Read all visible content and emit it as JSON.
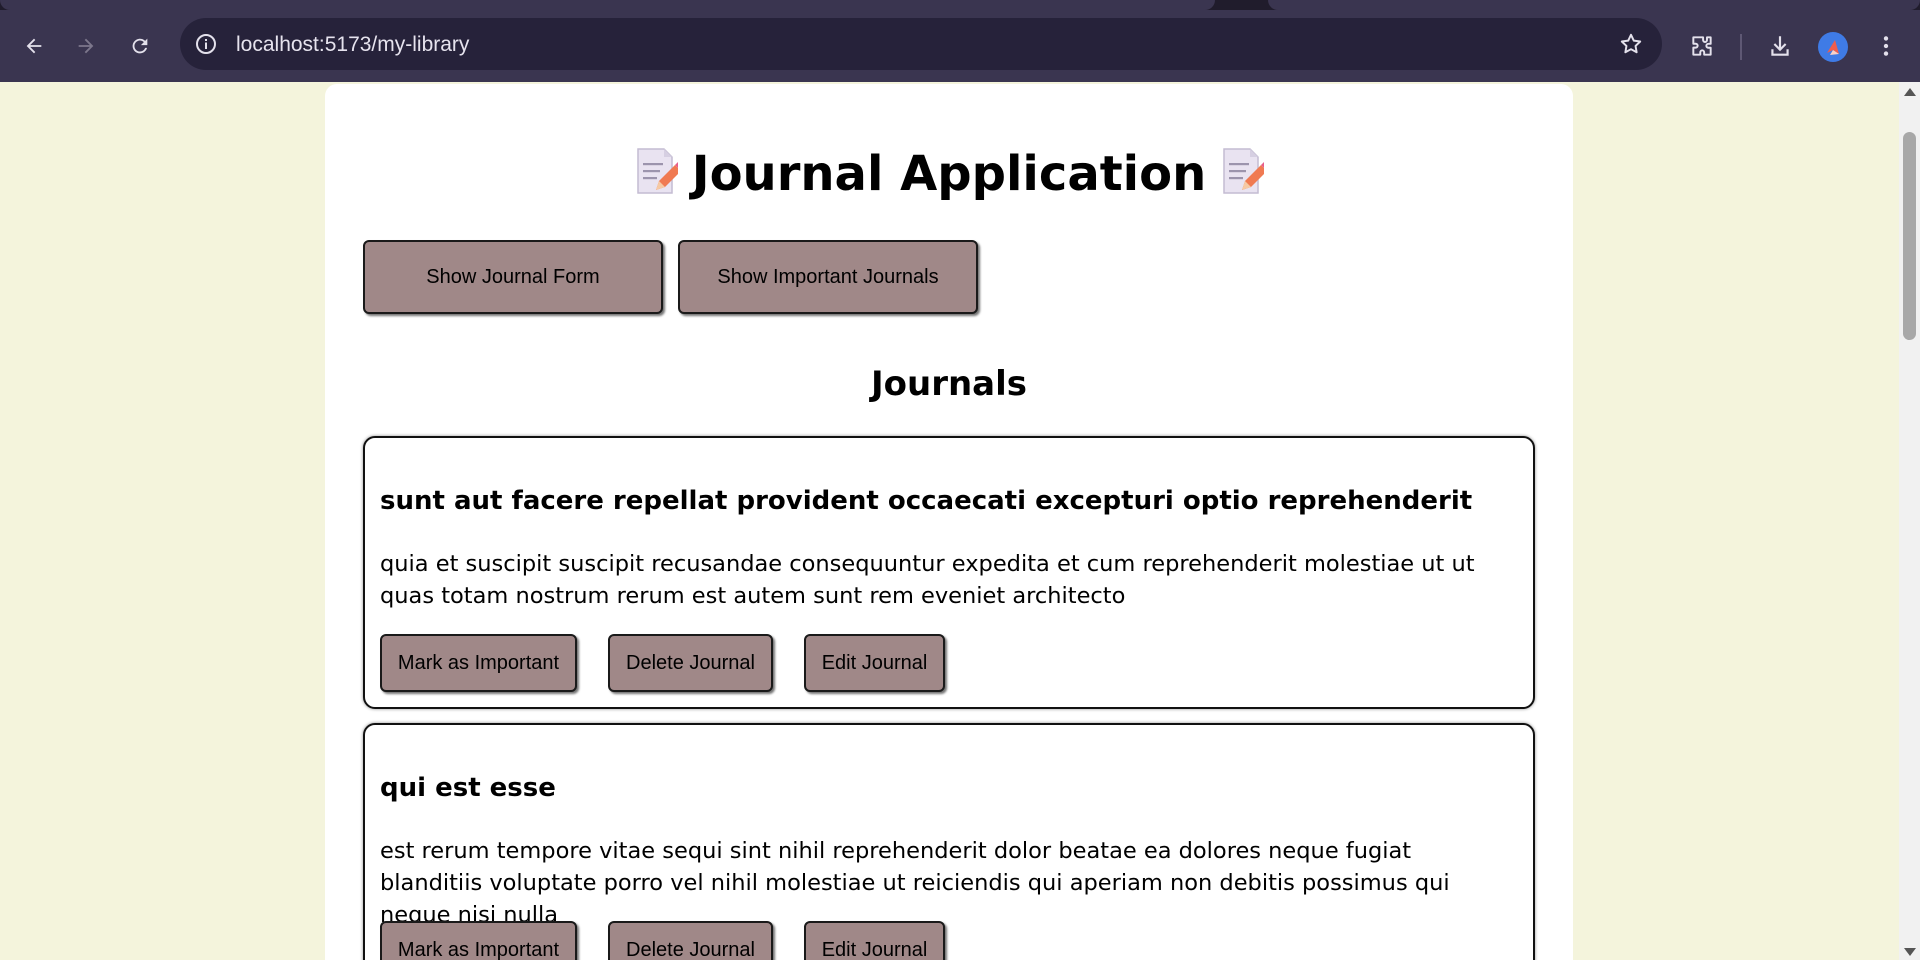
{
  "browser": {
    "url": "localhost:5173/my-library",
    "icons": [
      "back-arrow-icon",
      "forward-arrow-icon",
      "reload-icon",
      "site-info-icon",
      "bookmark-star-icon",
      "extensions-puzzle-icon",
      "download-icon",
      "profile-avatar",
      "more-menu-icon"
    ]
  },
  "app": {
    "title": "Journal Application",
    "title_icon": "memo-icon",
    "buttons": {
      "show_form": "Show Journal Form",
      "show_important": "Show Important Journals"
    },
    "journals_heading": "Journals",
    "journals": [
      {
        "title": "sunt aut facere repellat provident occaecati excepturi optio reprehenderit",
        "body": "quia et suscipit suscipit recusandae consequuntur expedita et cum reprehenderit molestiae ut ut quas totam nostrum rerum est autem sunt rem eveniet architecto",
        "mark_label": "Mark as Important",
        "delete_label": "Delete Journal",
        "edit_label": "Edit Journal"
      },
      {
        "title": "qui est esse",
        "body": "est rerum tempore vitae sequi sint nihil reprehenderit dolor beatae ea dolores neque fugiat blanditiis voluptate porro vel nihil molestiae ut reiciendis qui aperiam non debitis possimus qui neque nisi nulla",
        "mark_label": "Mark as Important",
        "delete_label": "Delete Journal",
        "edit_label": "Edit Journal"
      }
    ]
  },
  "colors": {
    "page_background": "#f4f4dc",
    "card_background": "#ffffff",
    "button_background": "#a08888",
    "browser_toolbar": "#3a3550"
  }
}
